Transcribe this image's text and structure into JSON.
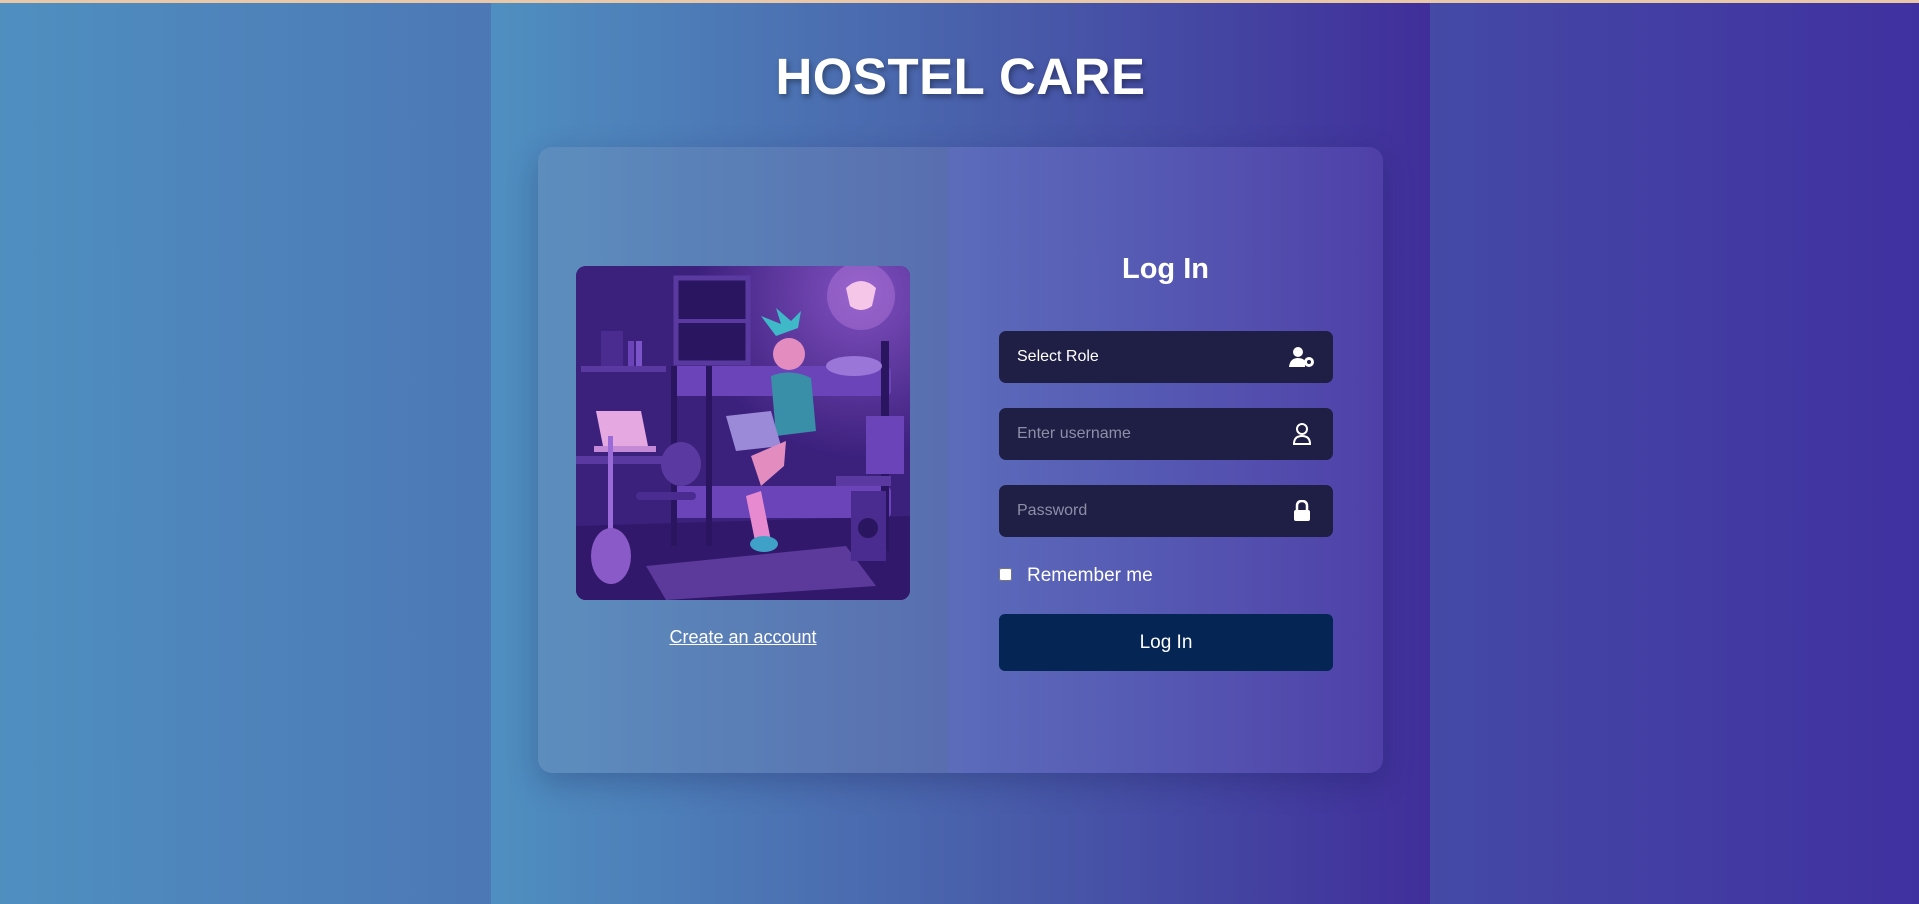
{
  "app": {
    "title": "HOSTEL CARE"
  },
  "illustration": {
    "alt": "dorm room illustration"
  },
  "links": {
    "create_account": "Create an account"
  },
  "login": {
    "heading": "Log In",
    "role_label": "Select Role",
    "username_placeholder": "Enter username",
    "password_placeholder": "Password",
    "remember_label": "Remember me",
    "submit_label": "Log In"
  },
  "icons": {
    "role": "user-cog-icon",
    "username": "user-icon",
    "password": "lock-icon"
  },
  "colors": {
    "input_bg": "#1f1e44",
    "button_bg": "#052654",
    "text": "#ffffff"
  }
}
